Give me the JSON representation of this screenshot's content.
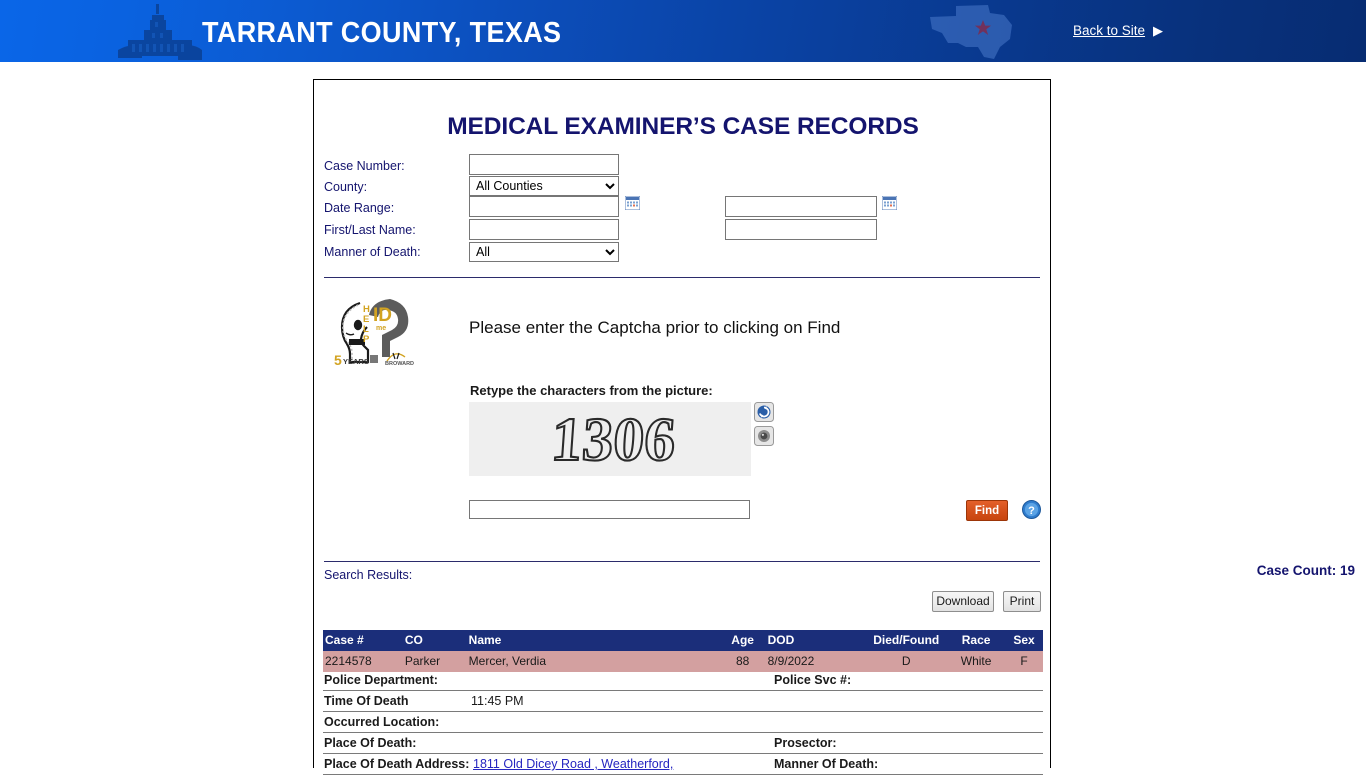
{
  "banner": {
    "title": "TARRANT COUNTY, TEXAS",
    "back_link": "Back to Site",
    "back_arrow": "▶",
    "courthouse_icon": "courthouse-silhouette-icon",
    "texas_map_icon": "texas-state-map-icon",
    "gradient_start": "#0a66e8",
    "gradient_end": "#072c72",
    "star_color": "#d92b2b"
  },
  "page": {
    "title": "MEDICAL EXAMINER’S CASE RECORDS",
    "title_color": "#14146e"
  },
  "search_form": {
    "fields": [
      {
        "label": "Case Number:",
        "type": "text",
        "value": "",
        "placeholder": ""
      },
      {
        "label": "County:",
        "type": "select",
        "value": "All Counties"
      },
      {
        "label": "Date Range:",
        "type": "text",
        "value": "",
        "placeholder": ""
      },
      {
        "label": "First/Last Name:",
        "type": "text",
        "value": "",
        "placeholder": ""
      },
      {
        "label": "Manner of Death:",
        "type": "select",
        "value": "All"
      }
    ],
    "date_to_value": "",
    "last_name_value": "",
    "calendar_icon": "calendar-icon"
  },
  "captcha": {
    "logo_alt": "help-id-me-logo",
    "logo_text_help": "HELP",
    "logo_text_id": "ID",
    "logo_text_me": "me",
    "logo_years_number": "5",
    "logo_years_word": "YEARS",
    "message": "Please enter the Captcha prior to clicking on Find",
    "retype_label": "Retype the characters from the picture:",
    "image_characters": "1306",
    "input_value": "",
    "refresh_icon": "refresh-captcha-icon",
    "audio_icon": "audio-captcha-icon",
    "find_label": "Find",
    "find_color": "#d4511c",
    "help_icon": "help-question-icon"
  },
  "results": {
    "label": "Search Results:",
    "case_count": "Case Count: 19",
    "download_label": "Download",
    "print_label": "Print",
    "columns": [
      "Case #",
      "CO",
      "Name",
      "Age",
      "DOD",
      "Died/Found",
      "Race",
      "Sex"
    ],
    "header_bg": "#1b2e7a",
    "row_bg": "#d3a0a0",
    "rows": [
      {
        "case": "2214578",
        "co": "Parker",
        "name": "Mercer, Verdia",
        "age": "88",
        "dod": "8/9/2022",
        "died_found": "D",
        "race": "White",
        "sex": "F"
      }
    ],
    "detail": [
      {
        "key": "Police Department:",
        "value": "",
        "key2": "Police Svc #:"
      },
      {
        "key": "Time Of Death",
        "value": "11:45 PM",
        "key2": ""
      },
      {
        "key": "Occurred Location:",
        "value": "",
        "key2": ""
      },
      {
        "key": "Place Of Death:",
        "value": "",
        "key2": "Prosector:"
      },
      {
        "key": "Place Of Death Address:",
        "value": "1811 Old Dicey Road , Weatherford,",
        "key2": "Manner Of Death:",
        "value_is_link": true
      }
    ]
  }
}
